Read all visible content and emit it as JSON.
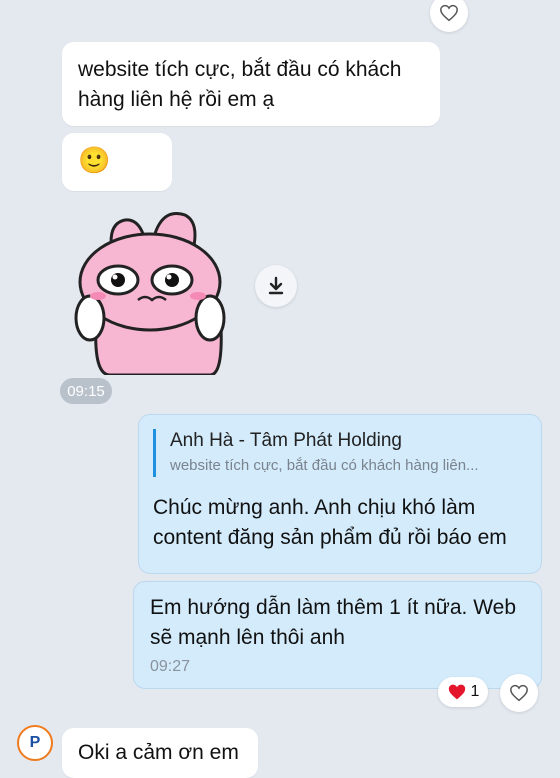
{
  "messages": {
    "m1": {
      "text": "website tích cực, bắt đầu có khách\nhàng liên hệ rồi em ạ"
    },
    "m2": {
      "emoji": "🙂"
    },
    "m3": {
      "sticker": "pink-bunny-crying-sticker",
      "time": "09:15",
      "download_icon": "download-icon"
    },
    "m4": {
      "quote_author": "Anh Hà - Tâm Phát Holding",
      "quote_text": "website tích cực, bắt đầu có khách hàng liên...",
      "text": "Chúc mừng anh. Anh chịu khó làm\ncontent đăng sản phẩm đủ rồi báo em"
    },
    "m5": {
      "text": "Em hướng dẫn làm thêm 1 ít nữa. Web\nsẽ mạnh lên thôi anh",
      "time": "09:27",
      "reaction_emoji": "❤️",
      "reaction_count": "1"
    },
    "m6": {
      "text": "Oki a cảm ơn em",
      "avatar_letter": "P"
    }
  },
  "colors": {
    "background": "#e4e9f0",
    "bubble_incoming": "#ffffff",
    "bubble_outgoing": "#d3ebfb",
    "quote_bar": "#1f8fe0"
  }
}
